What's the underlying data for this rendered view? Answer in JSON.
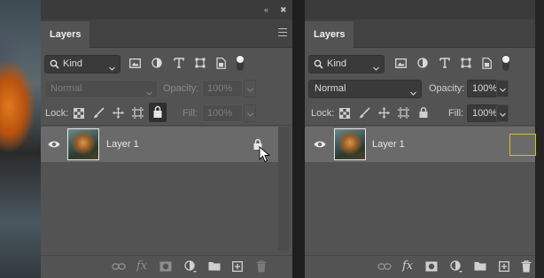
{
  "left_panel": {
    "tab_label": "Layers",
    "filter_kind": "Kind",
    "blend_mode": "Normal",
    "opacity_label": "Opacity:",
    "opacity_value": "100%",
    "lock_label": "Lock:",
    "fill_label": "Fill:",
    "fill_value": "100%",
    "layer": {
      "name": "Layer 1"
    }
  },
  "right_panel": {
    "tab_label": "Layers",
    "filter_kind": "Kind",
    "blend_mode": "Normal",
    "opacity_label": "Opacity:",
    "opacity_value": "100%",
    "lock_label": "Lock:",
    "fill_label": "Fill:",
    "fill_value": "100%",
    "layer": {
      "name": "Layer 1"
    }
  },
  "colors": {
    "panel_bg": "#535353",
    "selected_row": "#6a6a6a",
    "highlight_box": "#d6c21a"
  },
  "icons": {
    "filter_icons": [
      "image-filter-icon",
      "adjustment-filter-icon",
      "type-filter-icon",
      "shape-filter-icon",
      "smart-object-filter-icon",
      "filter-toggle-icon"
    ],
    "lock_icons": [
      "lock-transparent-pixels-icon",
      "lock-image-pixels-icon",
      "lock-position-icon",
      "lock-artboard-icon",
      "lock-all-icon"
    ],
    "footer_icons": [
      "link-layers-icon",
      "fx-icon",
      "add-mask-icon",
      "new-adjustment-layer-icon",
      "new-group-icon",
      "new-layer-icon",
      "delete-layer-icon"
    ]
  }
}
